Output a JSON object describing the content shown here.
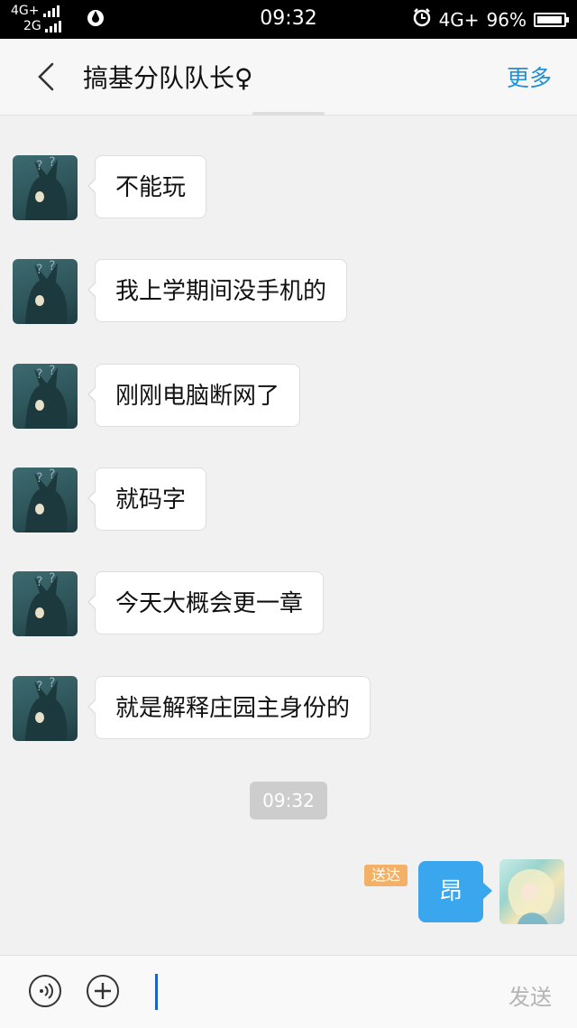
{
  "status_bar": {
    "network_top": "4G+",
    "network_bottom": "2G",
    "time": "09:32",
    "network_right": "4G+",
    "battery_text": "96%",
    "battery_level": 0.96
  },
  "header": {
    "title": "搞基分队队长♀",
    "more_label": "更多"
  },
  "messages": [
    {
      "text": "不能玩"
    },
    {
      "text": "我上学期间没手机的"
    },
    {
      "text": "刚刚电脑断网了"
    },
    {
      "text": "就码字"
    },
    {
      "text": "今天大概会更一章"
    },
    {
      "text": "就是解释庄园主身份的"
    }
  ],
  "timestamp": "09:32",
  "outgoing": {
    "status": "送达",
    "text": "昂"
  },
  "input_bar": {
    "send_label": "发送"
  },
  "colors": {
    "accent": "#1e90d6",
    "outgoing_bubble": "#3aa6ee",
    "sent_badge": "#f3b167"
  }
}
